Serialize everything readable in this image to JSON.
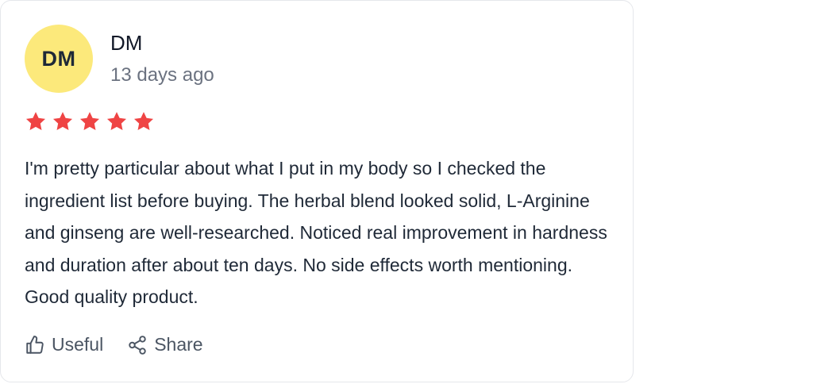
{
  "review": {
    "avatar_initials": "DM",
    "avatar_color": "#fce97b",
    "author": "DM",
    "date": "13 days ago",
    "rating": 5,
    "star_color": "#ef4444",
    "text": "I'm pretty particular about what I put in my body so I checked the ingredient list before buying. The herbal blend looked solid, L-Arginine and ginseng are well-researched. Noticed real improvement in hardness and duration after about ten days. No side effects worth mentioning. Good quality product."
  },
  "actions": {
    "useful_label": "Useful",
    "useful_icon": "thumbs-up-icon",
    "share_label": "Share",
    "share_icon": "share-icon"
  }
}
